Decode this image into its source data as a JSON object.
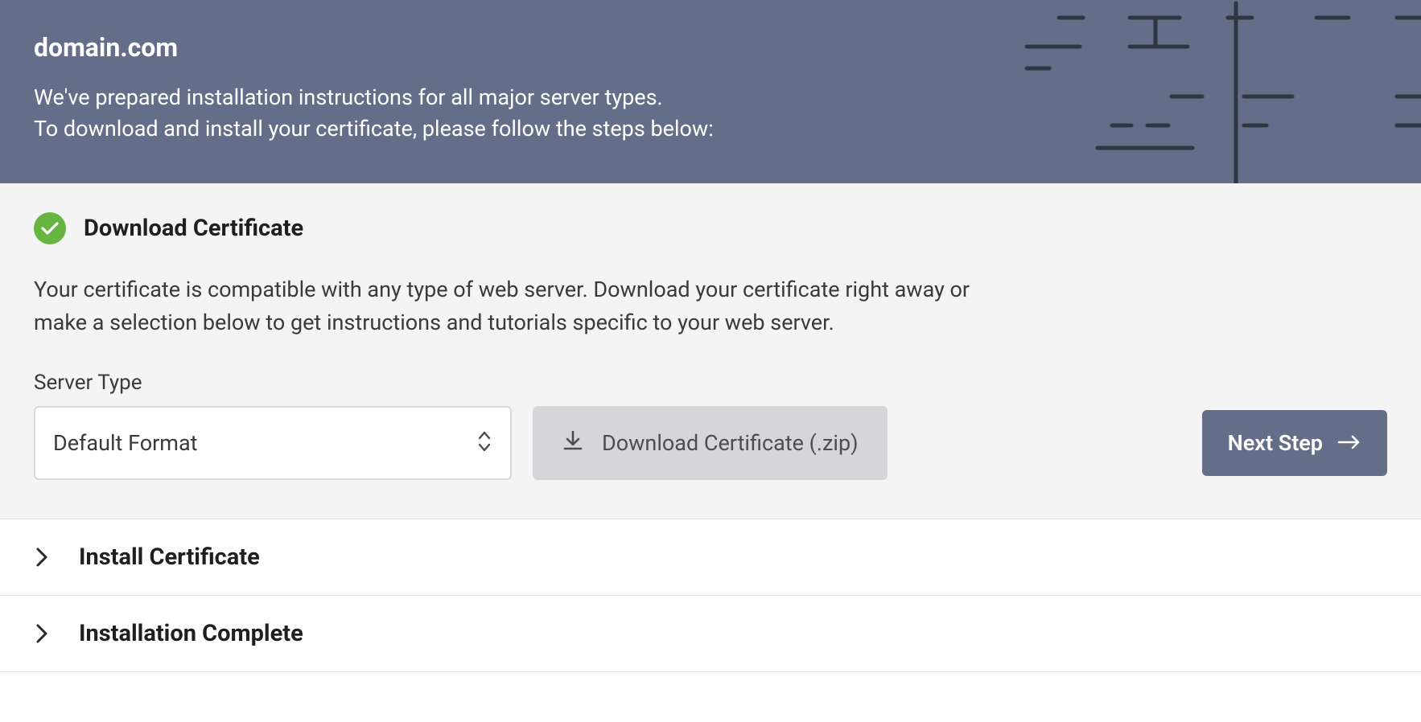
{
  "header": {
    "title": "domain.com",
    "description_line1": "We've prepared installation instructions for all major server types.",
    "description_line2": "To download and install your certificate, please follow the steps below:"
  },
  "steps": {
    "download": {
      "title": "Download Certificate",
      "body": "Your certificate is compatible with any type of web server. Download your certificate right away or make a selection below to get instructions and tutorials specific to your web server.",
      "server_type_label": "Server Type",
      "server_type_value": "Default Format",
      "download_button": "Download Certificate (.zip)",
      "next_button": "Next Step"
    },
    "install": {
      "title": "Install Certificate"
    },
    "complete": {
      "title": "Installation Complete"
    }
  }
}
